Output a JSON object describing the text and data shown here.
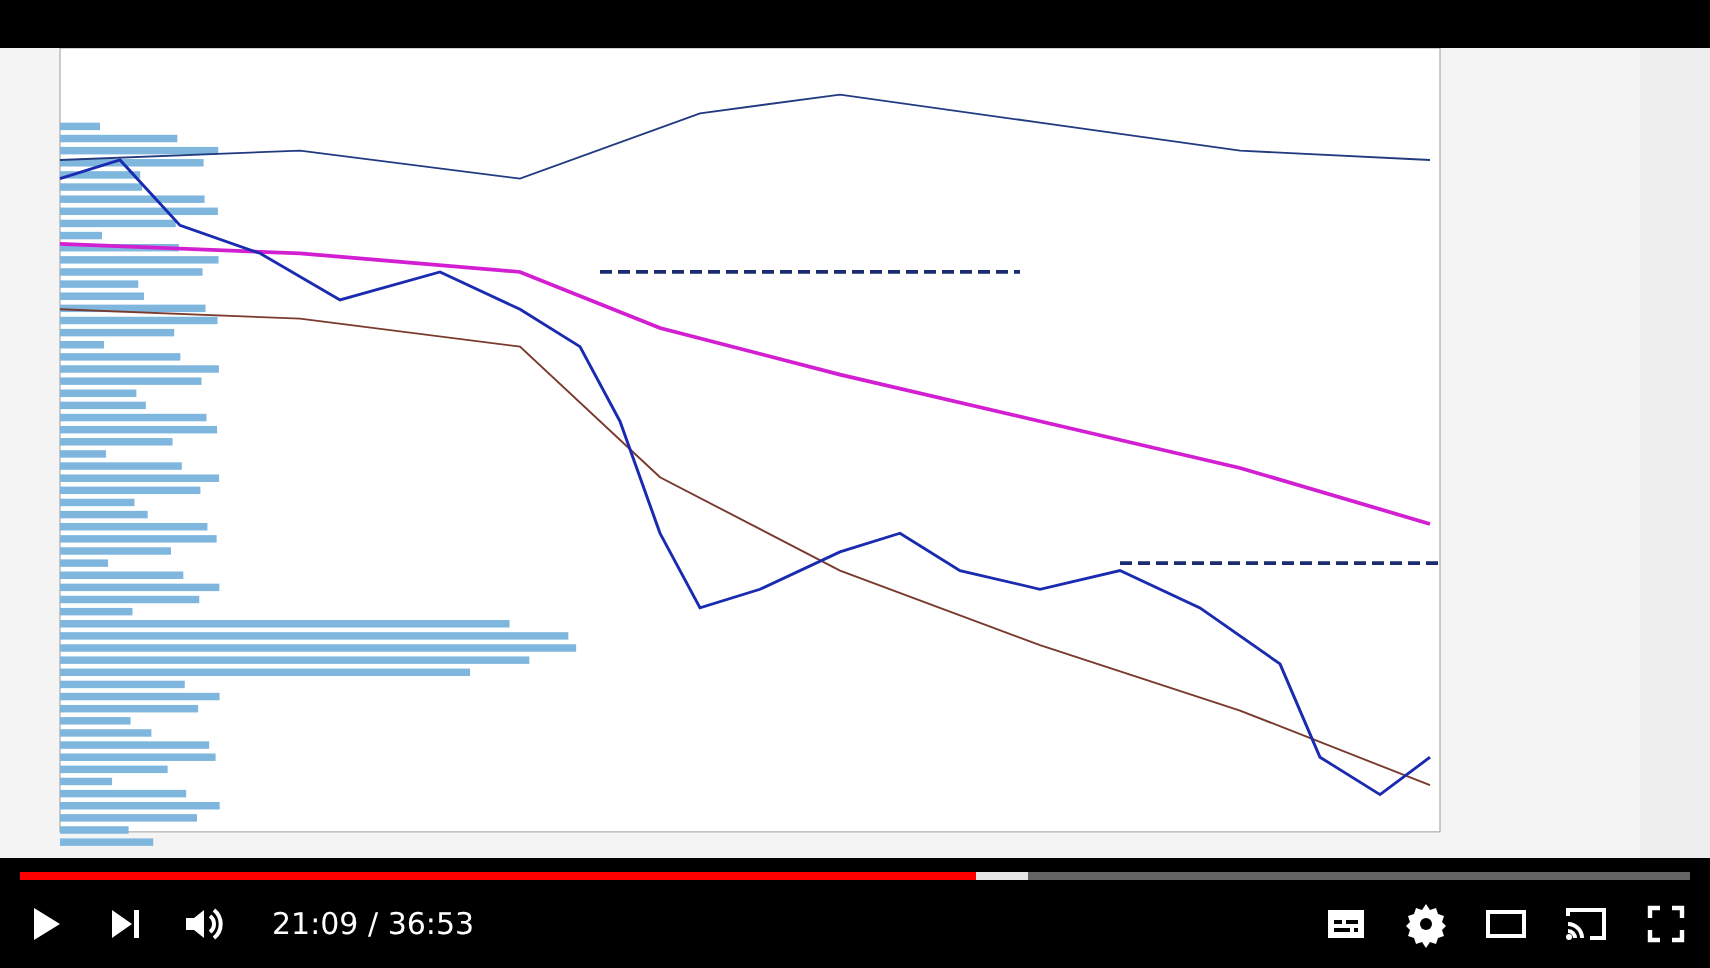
{
  "player": {
    "progress": {
      "level": 0.573
    },
    "buffered": {
      "level": 0.603
    },
    "time": "21:09 / 36:53"
  }
}
